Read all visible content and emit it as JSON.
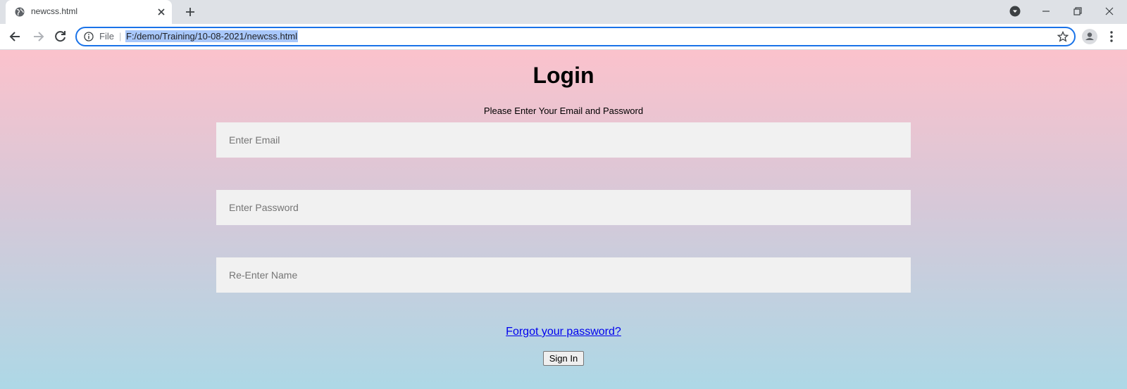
{
  "browser": {
    "tab_title": "newcss.html",
    "scheme_label": "File",
    "separator": "|",
    "url": "F:/demo/Training/10-08-2021/newcss.html"
  },
  "login": {
    "heading": "Login",
    "subtitle": "Please Enter Your Email and Password",
    "email_placeholder": "Enter Email",
    "password_placeholder": "Enter Password",
    "reenter_placeholder": "Re-Enter Name",
    "forgot_link": "Forgot your password?",
    "signin_button": "Sign In"
  },
  "colors": {
    "gradient_top": "#fbc2cc",
    "gradient_bottom": "#add8e6",
    "field_bg": "#f1f1f1",
    "link": "#0000ee",
    "omnibox_focus": "#1a73e8"
  }
}
